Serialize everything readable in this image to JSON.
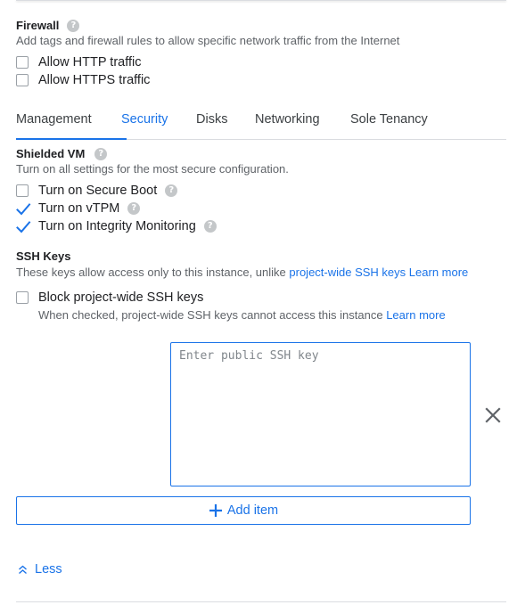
{
  "firewall": {
    "title": "Firewall",
    "help_icon": "help-icon",
    "description": "Add tags and firewall rules to allow specific network traffic from the Internet",
    "options": [
      {
        "label": "Allow HTTP traffic",
        "checked": false
      },
      {
        "label": "Allow HTTPS traffic",
        "checked": false
      }
    ]
  },
  "tabs": {
    "items": [
      {
        "label": "Management"
      },
      {
        "label": "Security"
      },
      {
        "label": "Disks"
      },
      {
        "label": "Networking"
      },
      {
        "label": "Sole Tenancy"
      }
    ],
    "active": "Security"
  },
  "shielded_vm": {
    "title": "Shielded VM",
    "description": "Turn on all settings for the most secure configuration.",
    "options": [
      {
        "label": "Turn on Secure Boot",
        "checked": false
      },
      {
        "label": "Turn on vTPM",
        "checked": true
      },
      {
        "label": "Turn on Integrity Monitoring",
        "checked": true
      }
    ]
  },
  "ssh_keys": {
    "title": "SSH Keys",
    "description": "These keys allow access only to this instance, unlike",
    "project_link": "project-wide SSH keys",
    "learn_more": "Learn more",
    "block_option": {
      "label": "Block project-wide SSH keys",
      "checked": false,
      "hint": "When checked, project-wide SSH keys cannot access this instance",
      "learn_more": "Learn more"
    },
    "key_input": {
      "value": "",
      "placeholder": "Enter public SSH key"
    },
    "remove_icon": "close-icon",
    "add_item_label": "Add item"
  },
  "less_toggle": {
    "label": "Less",
    "icon": "double-chevron-up-icon"
  },
  "colors": {
    "accent": "#1a73e8",
    "text": "#202124",
    "secondary_text": "#5f6368",
    "divider": "#dadce0"
  }
}
